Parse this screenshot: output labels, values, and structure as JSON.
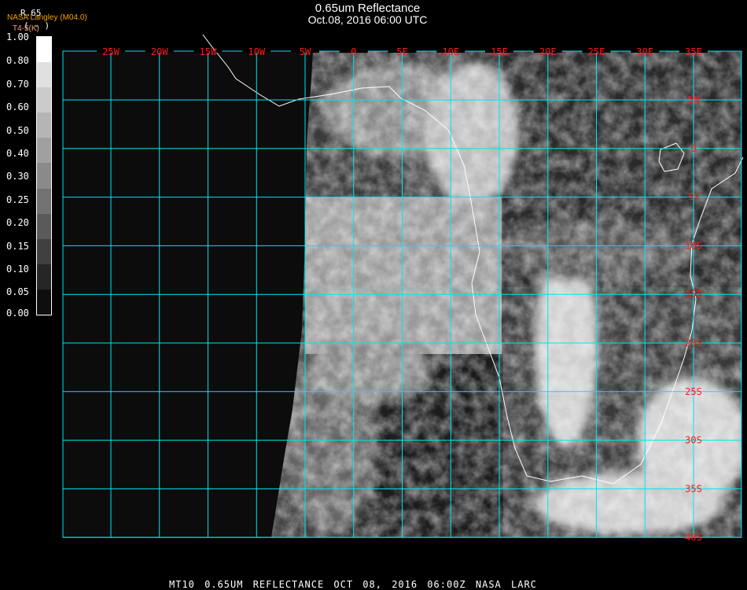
{
  "header": {
    "title": "0.65um Reflectance",
    "subtitle": "Oct.08, 2016 06:00 UTC"
  },
  "legend": {
    "source": "NASA Langley (M04.0)",
    "variable": "R.65",
    "units": "( - )",
    "overlay": "T4-5(K)",
    "labels": [
      "1.00",
      "0.80",
      "0.70",
      "0.60",
      "0.50",
      "0.40",
      "0.30",
      "0.25",
      "0.20",
      "0.15",
      "0.10",
      "0.05",
      "0.00"
    ],
    "colors": [
      "#ffffff",
      "#e0e0e0",
      "#cbcbcb",
      "#b5b5b5",
      "#a0a0a0",
      "#8a8a8a",
      "#727272",
      "#5a5a5a",
      "#404040",
      "#262626",
      "#0e0e0e"
    ]
  },
  "grid": {
    "color": "#00e5ee",
    "label_color": "#ff1a1a",
    "longitudes": [
      "25W",
      "20W",
      "15W",
      "10W",
      "5W",
      "0",
      "5E",
      "10E",
      "15E",
      "20E",
      "25E",
      "30E",
      "35E"
    ],
    "latitudes": [
      "5N",
      "0",
      "5S",
      "10S",
      "15S",
      "20S",
      "25S",
      "30S",
      "35S",
      "40S"
    ]
  },
  "footer": {
    "caption": "MT10  0.65UM REFLECTANCE   OCT 08, 2016 06:00Z   NASA LARC"
  }
}
